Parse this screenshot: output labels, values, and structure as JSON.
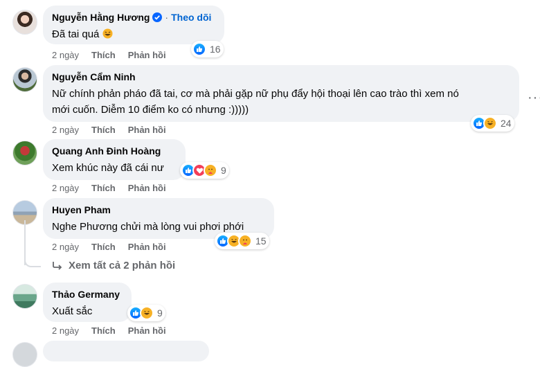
{
  "comments": [
    {
      "name": "Nguyễn Hằng Hương",
      "verified": true,
      "follow": "Theo dõi",
      "text": "Đã tai quá",
      "time": "2 ngày",
      "like_label": "Thích",
      "reply_label": "Phản hồi",
      "reactions": [
        "like"
      ],
      "count": "16"
    },
    {
      "name": "Nguyễn Cẩm Ninh",
      "text_line1": "Nữ chính phản pháo đã tai, cơ mà phải gặp nữ phụ đẩy hội thoại lên cao trào thì xem nó",
      "text_line2": "mới cuốn. Diễm 10 điểm ko có nhưng :)))))",
      "time": "2 ngày",
      "like_label": "Thích",
      "reply_label": "Phản hồi",
      "reactions": [
        "like",
        "haha"
      ],
      "count": "24"
    },
    {
      "name": "Quang Anh Đinh Hoàng",
      "text": "Xem khúc này đã cái nư",
      "time": "2 ngày",
      "like_label": "Thích",
      "reply_label": "Phản hồi",
      "reactions": [
        "like",
        "love",
        "care"
      ],
      "count": "9"
    },
    {
      "name": "Huyen Pham",
      "text": "Nghe Phương chửi mà lòng vui phơi phới",
      "time": "2 ngày",
      "like_label": "Thích",
      "reply_label": "Phản hồi",
      "reactions": [
        "like",
        "haha",
        "care"
      ],
      "count": "15"
    },
    {
      "name": "Thảo Germany",
      "text": "Xuất sắc",
      "time": "2 ngày",
      "like_label": "Thích",
      "reply_label": "Phản hồi",
      "reactions": [
        "like",
        "haha"
      ],
      "count": "9"
    }
  ],
  "view_replies": "Xem tất cả 2 phản hồi",
  "colors": {
    "bubble": "#f0f2f5",
    "meta": "#65676b",
    "link": "#0064d1",
    "like": "#0866ff",
    "haha": "#f7b125",
    "love": "#f33e58"
  }
}
